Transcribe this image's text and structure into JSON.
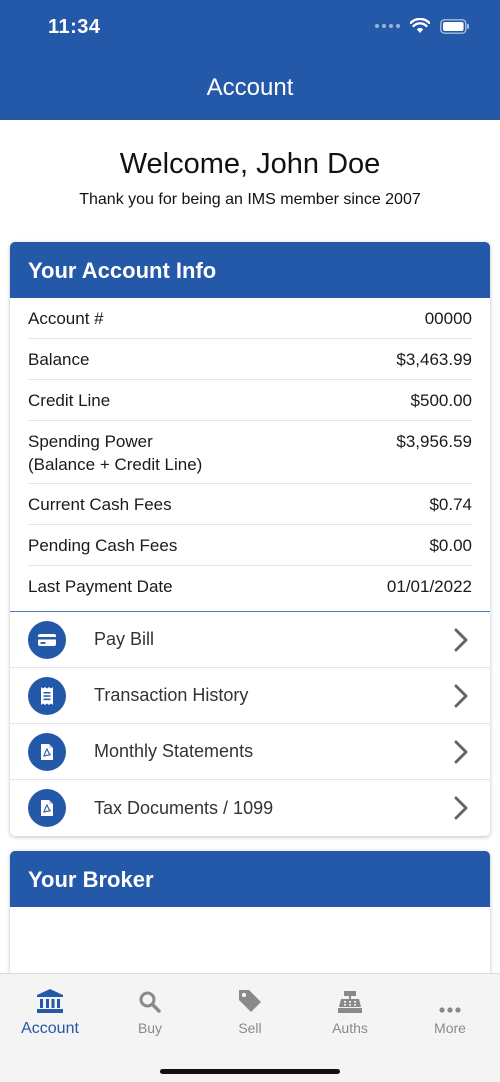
{
  "status_bar": {
    "time": "11:34"
  },
  "header": {
    "title": "Account"
  },
  "welcome": {
    "greeting": "Welcome, John Doe",
    "member_since": "Thank you for being an IMS member since 2007"
  },
  "account_info": {
    "title": "Your Account Info",
    "rows": [
      {
        "label": "Account #",
        "value": "00000"
      },
      {
        "label": "Balance",
        "value": "$3,463.99"
      },
      {
        "label": "Credit Line",
        "value": "$500.00"
      },
      {
        "label": "Spending Power",
        "sublabel": "(Balance + Credit Line)",
        "value": "$3,956.59"
      },
      {
        "label": "Current Cash Fees",
        "value": "$0.74"
      },
      {
        "label": "Pending Cash Fees",
        "value": "$0.00"
      },
      {
        "label": "Last Payment Date",
        "value": "01/01/2022"
      }
    ],
    "actions": [
      {
        "label": "Pay Bill",
        "icon": "credit-card-icon"
      },
      {
        "label": "Transaction History",
        "icon": "receipt-icon"
      },
      {
        "label": "Monthly Statements",
        "icon": "pdf-file-icon"
      },
      {
        "label": "Tax Documents / 1099",
        "icon": "pdf-file-icon"
      }
    ]
  },
  "broker": {
    "title": "Your Broker"
  },
  "tabbar": {
    "items": [
      {
        "label": "Account",
        "icon": "bank-icon",
        "active": true
      },
      {
        "label": "Buy",
        "icon": "search-icon",
        "active": false
      },
      {
        "label": "Sell",
        "icon": "tag-icon",
        "active": false
      },
      {
        "label": "Auths",
        "icon": "cash-register-icon",
        "active": false
      },
      {
        "label": "More",
        "icon": "more-dots-icon",
        "active": false
      }
    ]
  },
  "colors": {
    "brand": "#2458a8",
    "tab_inactive": "#8a8a8a"
  }
}
